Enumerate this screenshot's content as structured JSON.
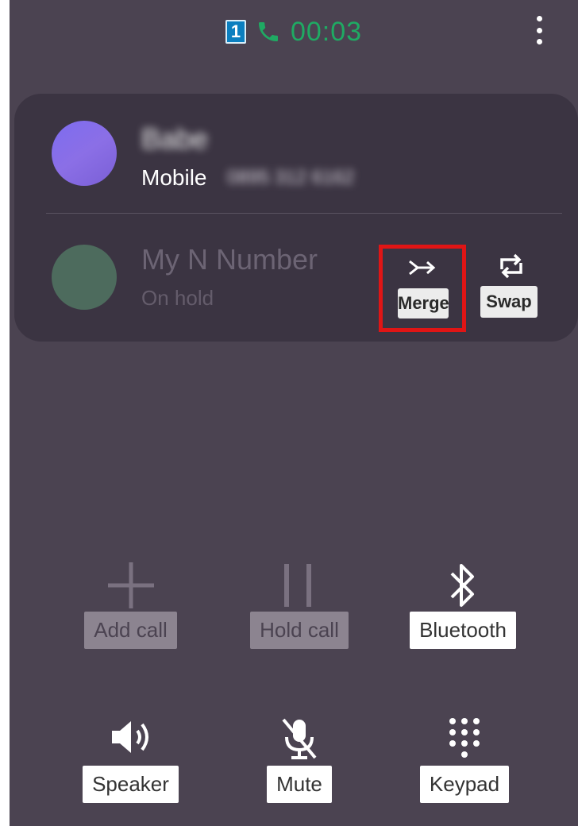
{
  "topbar": {
    "sim_slot": "1",
    "timer": "00:03",
    "call_icon": "phone-icon",
    "menu_icon": "more-vert-icon"
  },
  "active_call": {
    "name": "Babe",
    "label": "Mobile",
    "number": "0895 312 6162"
  },
  "held_call": {
    "name": "My N Number",
    "status": "On hold",
    "merge_label": "Merge",
    "swap_label": "Swap",
    "highlight_color": "#e01515"
  },
  "controls": [
    {
      "label": "Add call",
      "icon": "plus-icon",
      "enabled": false
    },
    {
      "label": "Hold call",
      "icon": "pause-icon",
      "enabled": false
    },
    {
      "label": "Bluetooth",
      "icon": "bluetooth-icon",
      "enabled": true
    },
    {
      "label": "Speaker",
      "icon": "speaker-icon",
      "enabled": true
    },
    {
      "label": "Mute",
      "icon": "mic-off-icon",
      "enabled": true
    },
    {
      "label": "Keypad",
      "icon": "keypad-icon",
      "enabled": true
    }
  ],
  "colors": {
    "background": "#4b4351",
    "card": "#3b3442",
    "timer": "#1faa63",
    "sim": "#0b7fbf"
  }
}
